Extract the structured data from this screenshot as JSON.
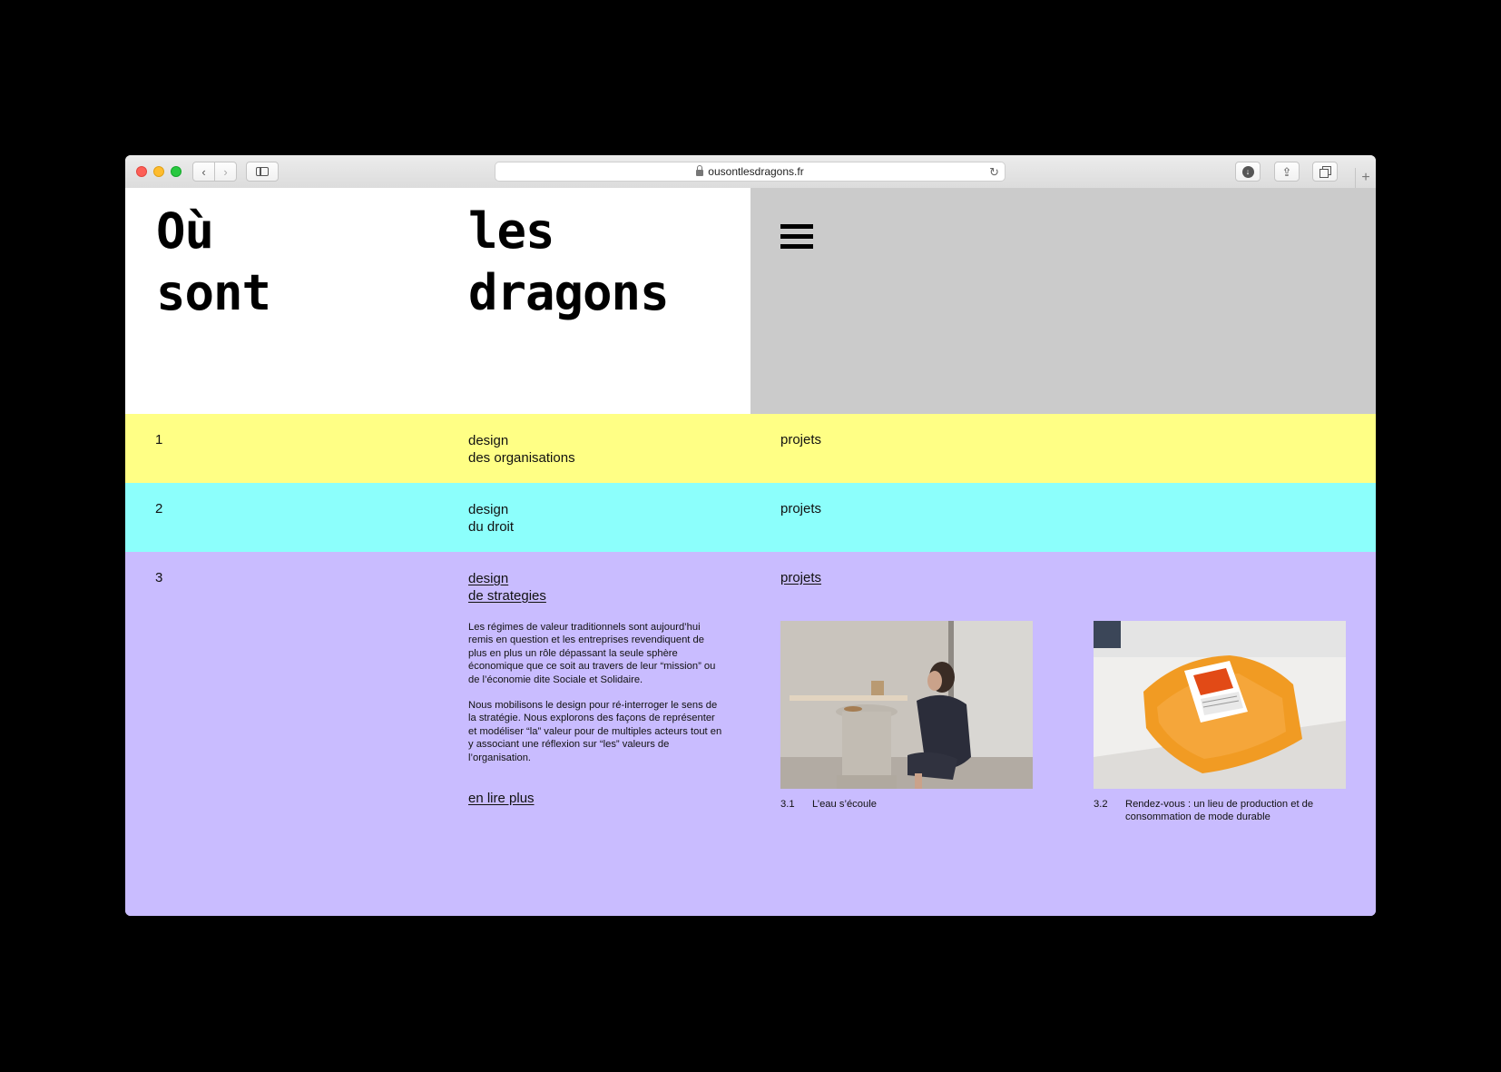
{
  "browser": {
    "url": "ousontlesdragons.fr",
    "back_label": "‹",
    "forward_label": "›",
    "reload_label": "↻",
    "download_label": "↓",
    "share_label": "⇪",
    "newtab_label": "+"
  },
  "header": {
    "logo_words": [
      "Où",
      "sont",
      "les",
      "dragons"
    ],
    "menu_icon": "hamburger-menu-icon",
    "bg_left": "#ffffff",
    "bg_right": "#cbcbcb"
  },
  "rows": [
    {
      "number": "1",
      "title_line1": "design",
      "title_line2": "des organisations",
      "projects_label": "projets",
      "color": "#ffff85"
    },
    {
      "number": "2",
      "title_line1": "design",
      "title_line2": "du droit",
      "projects_label": "projets",
      "color": "#8cfffc"
    },
    {
      "number": "3",
      "title_line1": "design",
      "title_line2": "de strategies",
      "projects_label": "projets",
      "color": "#c9bcff",
      "paragraph1": "Les régimes de valeur traditionnels sont aujourd’hui remis en question et les entreprises revendiquent de plus en plus un rôle dépassant la seule sphère économique que ce soit au travers de leur “mission” ou de l’économie dite Sociale et Solidaire.",
      "paragraph2": "Nous mobilisons le design pour ré-interroger le sens de la stratégie. Nous explorons des façons de représenter et modéliser “la” valeur pour de multiples acteurs tout en y associant une réflexion sur “les” valeurs de l’organisation.",
      "read_more": "en lire plus",
      "projects": [
        {
          "number": "3.1",
          "title": "L’eau s’écoule"
        },
        {
          "number": "3.2",
          "title": "Rendez-vous : un lieu de production et de consommation de mode durable"
        }
      ]
    }
  ]
}
